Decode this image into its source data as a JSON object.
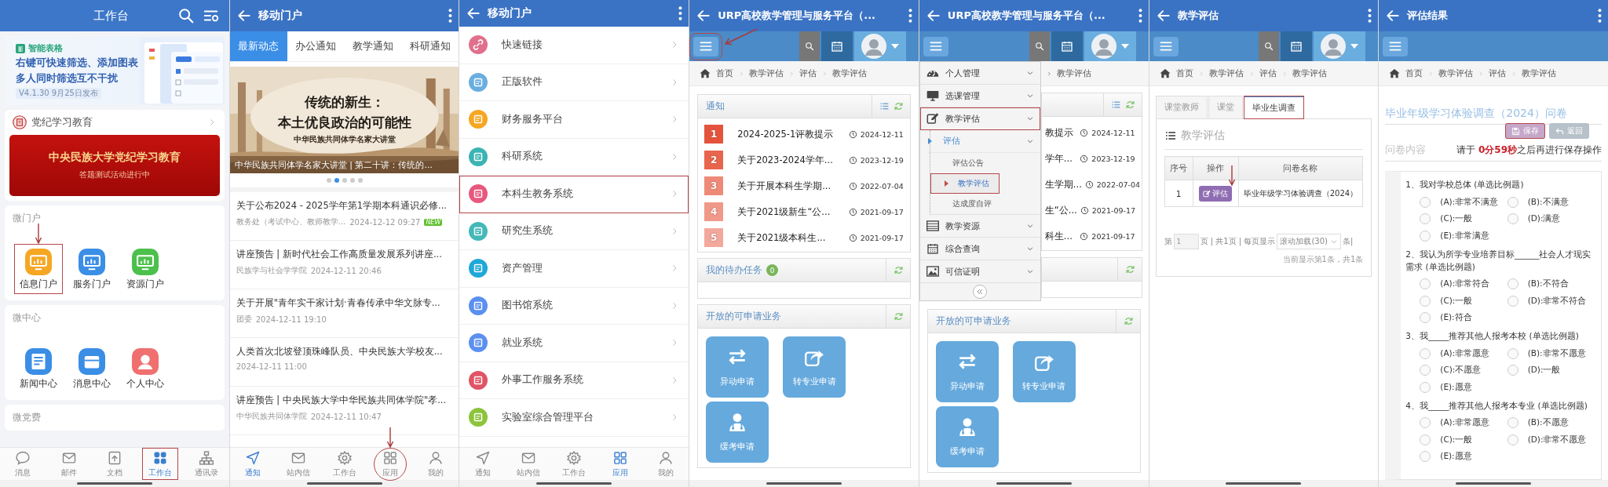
{
  "panels": [
    {
      "kind": "workbench",
      "header": {
        "title": "工作台"
      },
      "promo": {
        "tag": "智能表格",
        "lines": [
          "右键可快速筛选、添加图表",
          "多人同时筛选互不干扰"
        ],
        "version": "V4.1.30 9月25日发布"
      },
      "party": {
        "title": "党纪学习教育",
        "banner_title": "中央民族大学党纪学习教育",
        "banner_subtitle": "答题测试活动进行中"
      },
      "sections": [
        {
          "title": "微门户",
          "apps": [
            {
              "label": "信息门户",
              "color": "#f5a623",
              "highlight": true,
              "arrow": true
            },
            {
              "label": "服务门户",
              "color": "#3a8ee6"
            },
            {
              "label": "资源门户",
              "color": "#4cc04c"
            }
          ]
        },
        {
          "title": "微中心",
          "apps": [
            {
              "label": "新闻中心",
              "color": "#3a8ee6"
            },
            {
              "label": "消息中心",
              "color": "#3a8ee6"
            },
            {
              "label": "个人中心",
              "color": "#f07070"
            }
          ]
        },
        {
          "title": "微党费"
        }
      ],
      "tab_bar": [
        {
          "label": "消息",
          "selected": false
        },
        {
          "label": "邮件",
          "selected": false
        },
        {
          "label": "文档",
          "selected": false
        },
        {
          "label": "工作台",
          "selected": true,
          "highlight": true
        },
        {
          "label": "通讯录",
          "selected": false
        }
      ]
    },
    {
      "kind": "news",
      "header": {
        "title": "移动门户"
      },
      "tabs": [
        {
          "label": "最新动态",
          "selected": true
        },
        {
          "label": "办公通知",
          "selected": false
        },
        {
          "label": "教学通知",
          "selected": false
        },
        {
          "label": "科研通知",
          "selected": false
        }
      ],
      "banner": {
        "title_lines": [
          "传统的新生：",
          "本土优良政治的可能性"
        ],
        "subtitle": "中华民族共同体学名家大讲堂",
        "caption": "中华民族共同体学名家大讲堂 | 第二十讲：传统的..."
      },
      "carousel_dots": [
        {
          "selected": false
        },
        {
          "selected": true
        },
        {
          "selected": false
        },
        {
          "selected": false
        },
        {
          "selected": false
        }
      ],
      "news": [
        {
          "title": "关于公布2024 - 2025学年第1学期本科通识必修...",
          "source": "教务处（考试中心、教师教学...",
          "time": "2024-12-12 09:27",
          "badge": "NEW"
        },
        {
          "title": "讲座预告 | 新时代社会工作高质量发展系列讲座...",
          "source": "民族学与社会学学院",
          "time": "2024-12-11 20:46"
        },
        {
          "title": "关于开展\"青年实干家计划·青春传承中华文脉专...",
          "source": "团委",
          "time": "2024-12-11 19:10"
        },
        {
          "title": "人类首次北坡登顶珠峰队员、中央民族大学校友...",
          "time": "2024-12-11 11:00"
        },
        {
          "title": "讲座预告 | 中央民族大学中华民族共同体学院\"孝...",
          "source": "中华民族共同体学院",
          "time": "2024-12-11 10:47"
        }
      ],
      "tab_bar": [
        {
          "label": "通知",
          "selected": true
        },
        {
          "label": "站内信",
          "selected": false
        },
        {
          "label": "工作台",
          "selected": false
        },
        {
          "label": "应用",
          "selected": false,
          "circled": true,
          "arrow": true
        },
        {
          "label": "我的",
          "selected": false
        }
      ]
    },
    {
      "kind": "apps",
      "header": {
        "title": "移动门户"
      },
      "apps": [
        {
          "label": "快速链接",
          "color": "#e0708c"
        },
        {
          "label": "正版软件",
          "color": "#6aaee0"
        },
        {
          "label": "财务服务平台",
          "color": "#f5a623"
        },
        {
          "label": "科研系统",
          "color": "#3cb4b4"
        },
        {
          "label": "本科生教务系统",
          "color": "#e8587e",
          "highlight": true
        },
        {
          "label": "研究生系统",
          "color": "#45b8b8"
        },
        {
          "label": "资产管理",
          "color": "#1fa8d8"
        },
        {
          "label": "图书馆系统",
          "color": "#5b8ff0"
        },
        {
          "label": "就业系统",
          "color": "#5b8ff0"
        },
        {
          "label": "外事工作服务系统",
          "color": "#e05565"
        },
        {
          "label": "实验室综合管理平台",
          "color": "#8cc43c"
        }
      ],
      "tab_bar": [
        {
          "label": "通知",
          "selected": false
        },
        {
          "label": "站内信",
          "selected": false
        },
        {
          "label": "工作台",
          "selected": false
        },
        {
          "label": "应用",
          "selected": true
        },
        {
          "label": "我的",
          "selected": false
        }
      ]
    },
    {
      "kind": "urp",
      "header": {
        "title": "URP高校教学管理与服务平台（..."
      },
      "toolbar": {
        "kind": "full",
        "menu_highlight": true,
        "menu_arrow": true
      },
      "breadcrumb": [
        "首页",
        "教学评估",
        "评估",
        "教学评估"
      ],
      "notice": {
        "title": "通知",
        "items": [
          {
            "number": "1",
            "title": "2024-2025-1评教提示",
            "date": "2024-12-11",
            "color": "#e4543c"
          },
          {
            "number": "2",
            "title": "关于2023-2024学年...",
            "date": "2023-12-19",
            "color": "#e8654e"
          },
          {
            "number": "3",
            "title": "关于开展本科生学期...",
            "date": "2022-07-04",
            "color": "#ee8a78"
          },
          {
            "number": "4",
            "title": "关于2021级新生“公...",
            "date": "2021-09-17",
            "color": "#f0998a"
          },
          {
            "number": "5",
            "title": "关于2021级本科生...",
            "date": "2021-09-17",
            "color": "#f2a89c"
          }
        ]
      },
      "tasks": {
        "title": "我的待办任务",
        "count": "0"
      },
      "services": {
        "title": "开放的可申请业务",
        "items": [
          "异动申请",
          "转专业申请",
          "缓考申请"
        ]
      }
    },
    {
      "kind": "urp_menu",
      "header": {
        "title": "URP高校教学管理与服务平台（..."
      },
      "toolbar": {
        "kind": "full"
      },
      "breadcrumb_tail": "教学评估",
      "notice_fragments": [
        {
          "title": "教提示",
          "date": "2024-12-11"
        },
        {
          "title": "学年...",
          "date": "2023-12-19"
        },
        {
          "title": "生学期...",
          "date": "2022-07-04"
        },
        {
          "title": "生“公...",
          "date": "2021-09-17"
        },
        {
          "title": "科生...",
          "date": "2021-09-17"
        }
      ],
      "menu": [
        {
          "label": "个人管理"
        },
        {
          "label": "选课管理"
        },
        {
          "label": "教学评估",
          "highlight": true,
          "children": [
            {
              "label": "评估",
              "children": [
                {
                  "label": "评估公告",
                  "selected": false
                },
                {
                  "label": "教学评估",
                  "selected": true,
                  "highlight": true
                },
                {
                  "label": "达成度自评",
                  "selected": false
                }
              ]
            }
          ]
        },
        {
          "label": "教学资源"
        },
        {
          "label": "综合查询"
        },
        {
          "label": "可信证明"
        }
      ],
      "services": {
        "title": "开放的可申请业务",
        "items": [
          "异动申请",
          "转专业申请",
          "缓考申请"
        ]
      }
    },
    {
      "kind": "eval_list",
      "header": {
        "title": "教学评估"
      },
      "toolbar": {
        "kind": "full"
      },
      "breadcrumb": [
        "首页",
        "教学评估",
        "评估",
        "教学评估"
      ],
      "tabs": [
        {
          "label": "课堂教师",
          "selected": false
        },
        {
          "label": "课堂",
          "selected": false
        },
        {
          "label": "毕业生调查",
          "selected": true,
          "highlight": true
        }
      ],
      "section_title": "教学评估",
      "table": {
        "columns": [
          "序号",
          "操作",
          "问卷名称"
        ],
        "rows": [
          {
            "index": "1",
            "action": "评估",
            "action_arrow": true,
            "name": "毕业年级学习体验调查（2024）"
          }
        ]
      },
      "pagination": {
        "prefix": "第",
        "page": "1",
        "middle": "页 | 共1页 | 每页显示",
        "page_size": "滚动加载(30)",
        "suffix": "条|",
        "summary": "当前显示第1条，共1条"
      }
    },
    {
      "kind": "eval_form",
      "header": {
        "title": "评估结果"
      },
      "toolbar": {
        "kind": "menu_only"
      },
      "breadcrumb": [
        "首页",
        "教学评估",
        "评估",
        "教学评估"
      ],
      "title": "毕业年级学习体验调查（2024）问卷",
      "buttons": [
        {
          "kind": "save",
          "label": "保存",
          "highlight": true
        },
        {
          "kind": "back",
          "label": "返回"
        }
      ],
      "section_label": "问卷内容",
      "notice": "请于 **0分59秒**之后再进行保存操作",
      "questions": [
        {
          "text": "1、我对学校总体 (单选比例题)",
          "options": [
            {
              "label": "(A):非常不满意",
              "checked": false
            },
            {
              "label": "(B):不满意",
              "checked": false
            },
            {
              "label": "(C):一般",
              "checked": false
            },
            {
              "label": "(D):满意",
              "checked": false
            },
            {
              "label": "(E):非常满意",
              "checked": false
            }
          ]
        },
        {
          "text": "2、我认为所学专业培养目标______社会人才现实需求 (单选比例题)",
          "options": [
            {
              "label": "(A):非常符合",
              "checked": false
            },
            {
              "label": "(B):不符合",
              "checked": false
            },
            {
              "label": "(C):一般",
              "checked": false
            },
            {
              "label": "(D):非常不符合",
              "checked": false
            },
            {
              "label": "(E):符合",
              "checked": false
            }
          ]
        },
        {
          "text": "3、我_____推荐其他人报考本校 (单选比例题)",
          "options": [
            {
              "label": "(A):非常愿意",
              "checked": false
            },
            {
              "label": "(B):非常不愿意",
              "checked": false
            },
            {
              "label": "(C):不愿意",
              "checked": false
            },
            {
              "label": "(D):一般",
              "checked": false
            },
            {
              "label": "(E):愿意",
              "checked": false
            }
          ]
        },
        {
          "text": "4、我_____推荐其他人报考本专业 (单选比例题)",
          "options": [
            {
              "label": "(A):非常愿意",
              "checked": false
            },
            {
              "label": "(B):不愿意",
              "checked": false
            },
            {
              "label": "(C):一般",
              "checked": false
            },
            {
              "label": "(D):非常不愿意",
              "checked": false
            },
            {
              "label": "(E):愿意",
              "checked": false
            }
          ]
        }
      ]
    }
  ]
}
